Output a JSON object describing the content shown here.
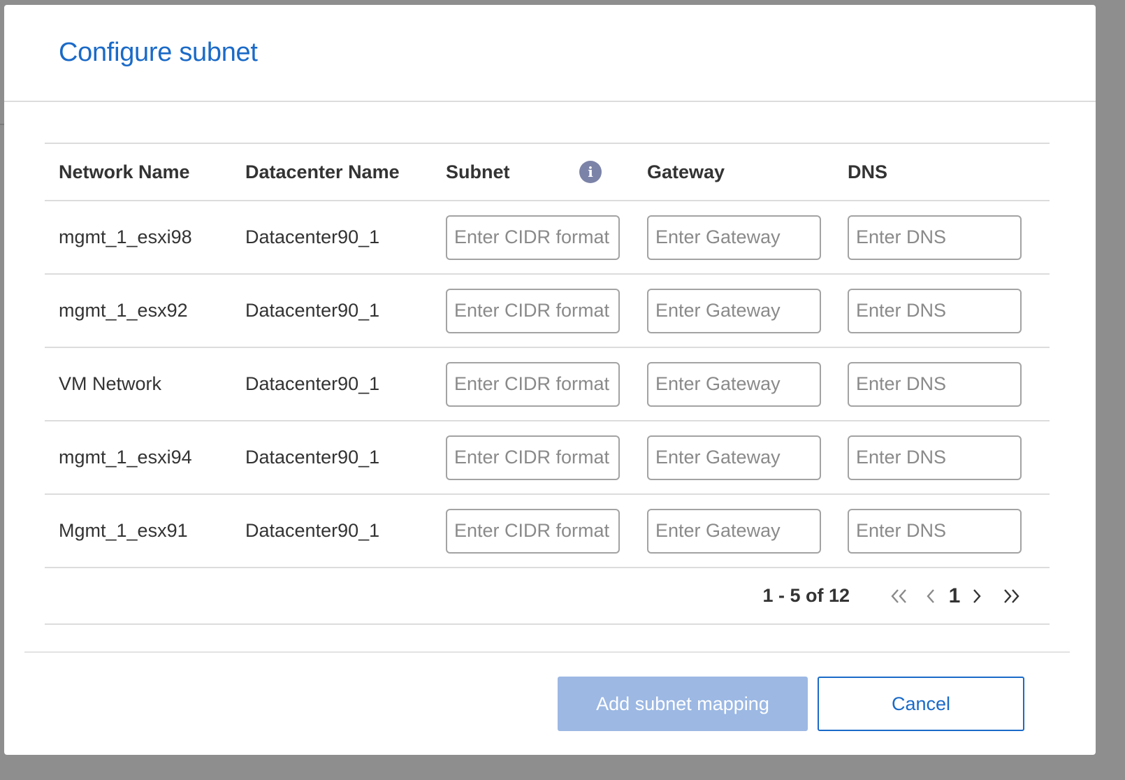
{
  "modal": {
    "title": "Configure subnet"
  },
  "table": {
    "headers": {
      "network_name": "Network Name",
      "datacenter_name": "Datacenter Name",
      "subnet": "Subnet",
      "gateway": "Gateway",
      "dns": "DNS"
    },
    "info_icon_glyph": "i",
    "placeholders": {
      "subnet": "Enter CIDR format",
      "gateway": "Enter Gateway",
      "dns": "Enter DNS"
    },
    "rows": [
      {
        "network": "mgmt_1_esxi98",
        "datacenter": "Datacenter90_1",
        "subnet": "",
        "gateway": "",
        "dns": ""
      },
      {
        "network": "mgmt_1_esx92",
        "datacenter": "Datacenter90_1",
        "subnet": "",
        "gateway": "",
        "dns": ""
      },
      {
        "network": "VM Network",
        "datacenter": "Datacenter90_1",
        "subnet": "",
        "gateway": "",
        "dns": ""
      },
      {
        "network": "mgmt_1_esxi94",
        "datacenter": "Datacenter90_1",
        "subnet": "",
        "gateway": "",
        "dns": ""
      },
      {
        "network": "Mgmt_1_esx91",
        "datacenter": "Datacenter90_1",
        "subnet": "",
        "gateway": "",
        "dns": ""
      }
    ]
  },
  "pagination": {
    "range": "1 - 5 of 12",
    "first": "«",
    "prev": "‹",
    "page": "1",
    "next": "›",
    "last": "»"
  },
  "footer": {
    "primary_label": "Add subnet mapping",
    "secondary_label": "Cancel"
  },
  "colors": {
    "accent": "#1a6ac8",
    "primary_disabled": "#9cb8e3",
    "info_icon": "#7c83a8"
  }
}
